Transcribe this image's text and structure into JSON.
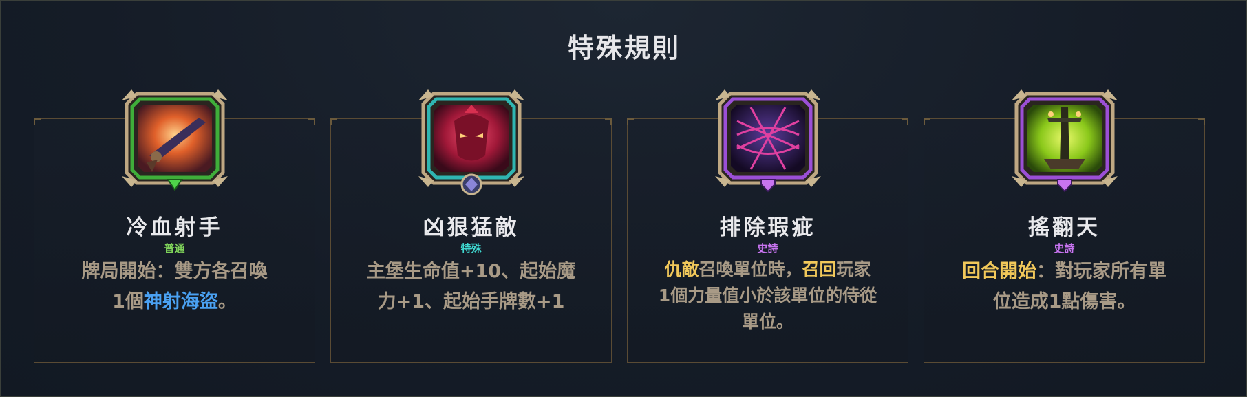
{
  "title": "特殊規則",
  "cards": [
    {
      "name": "冷血射手",
      "rarity": "普通",
      "rarity_color": "#7fd35a",
      "frame_color": "#3fae3a",
      "icon": "pistol-icon",
      "desc_a": "牌局開始：雙方各召喚",
      "desc_b": "1個",
      "desc_c": "神射海盜",
      "desc_d": "。"
    },
    {
      "name": "凶狠猛敵",
      "rarity": "特殊",
      "rarity_color": "#3fd8d0",
      "frame_color": "#2fb6b2",
      "icon": "demon-face-icon",
      "desc_a": "主堡生命值+10、起始魔",
      "desc_b": "力+1、起始手牌數+1"
    },
    {
      "name": "排除瑕疵",
      "rarity": "史詩",
      "rarity_color": "#c874f0",
      "frame_color": "#9b4fd6",
      "icon": "web-trap-icon",
      "desc_a": "仇敵",
      "desc_b": "召喚單位時，",
      "desc_c": "召回",
      "desc_d": "玩家",
      "desc_e": "1個力量值小於該單位的侍從",
      "desc_f": "單位。"
    },
    {
      "name": "搖翻天",
      "rarity": "史詩",
      "rarity_color": "#c874f0",
      "frame_color": "#9b4fd6",
      "icon": "lightning-tower-icon",
      "desc_a": "回合開始",
      "desc_b": "：對玩家所有單",
      "desc_c": "位造成1點傷害。"
    }
  ]
}
